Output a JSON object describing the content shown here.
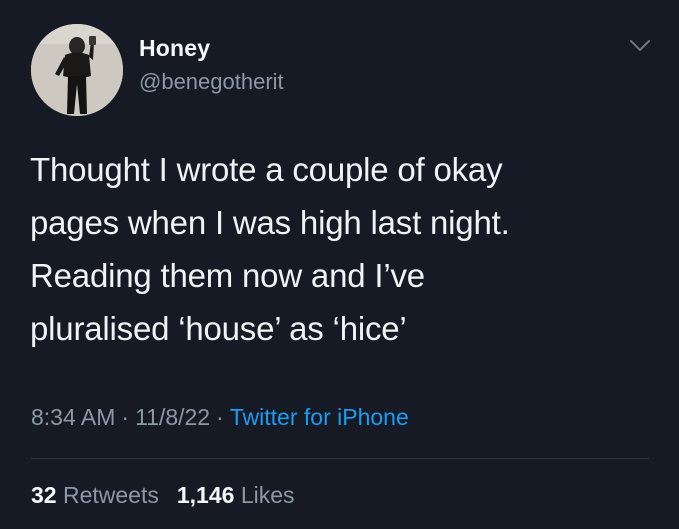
{
  "user": {
    "display_name": "Honey",
    "handle": "@benegotherit",
    "avatar_icon": "profile-photo"
  },
  "menu_icon": "chevron-down-icon",
  "tweet": {
    "text": "Thought I wrote a couple of okay\npages when I was high last night.\nReading them now and I’ve\npluralised ‘house’ as ‘hice’",
    "time": "8:34 AM",
    "separator": "·",
    "date": "11/8/22",
    "source": "Twitter for iPhone"
  },
  "stats": {
    "retweets_count": "32",
    "retweets_label": "Retweets",
    "likes_count": "1,146",
    "likes_label": "Likes"
  },
  "colors": {
    "background": "#151a24",
    "text": "#f0f3f5",
    "secondary": "#8b98a5",
    "accent": "#1d9bf0"
  }
}
